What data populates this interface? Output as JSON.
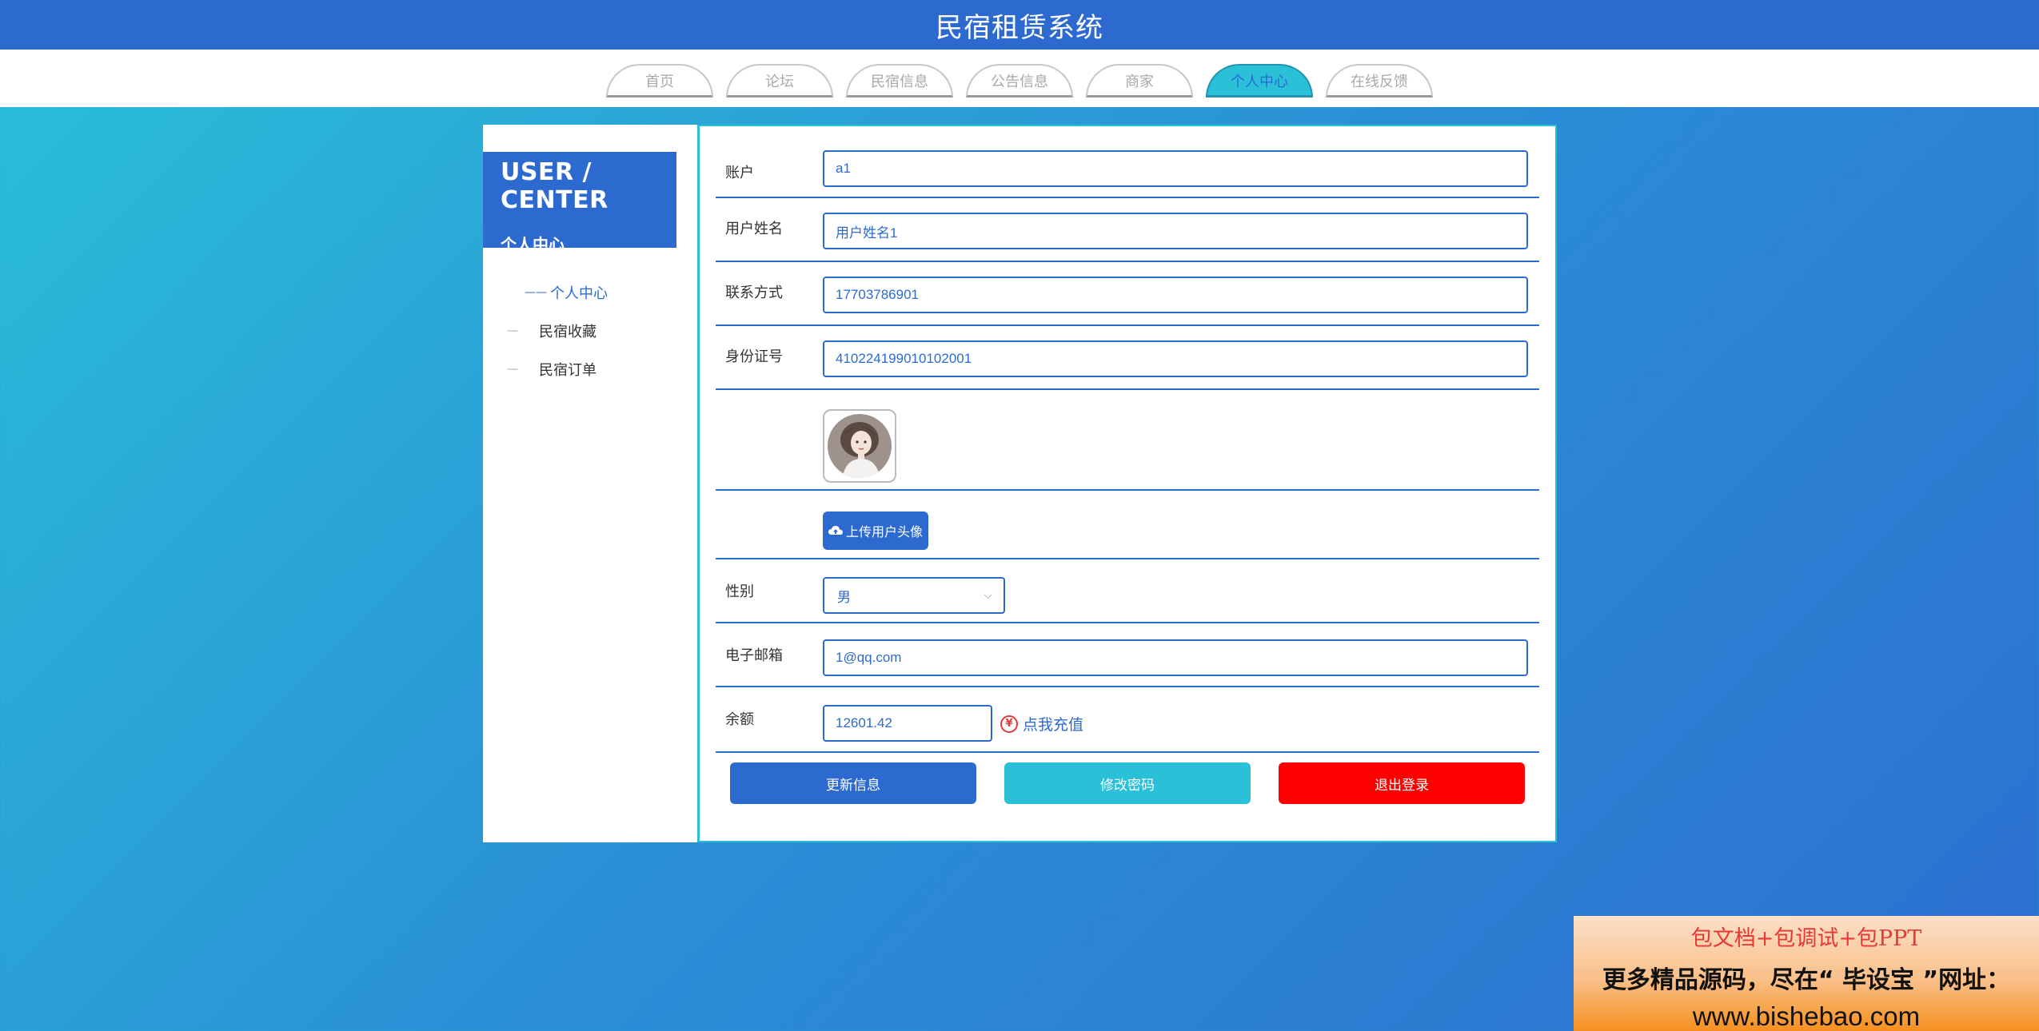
{
  "header": {
    "title": "民宿租赁系统"
  },
  "nav": {
    "tabs": [
      "首页",
      "论坛",
      "民宿信息",
      "公告信息",
      "商家",
      "个人中心",
      "在线反馈"
    ],
    "active_index": 5
  },
  "sidebar": {
    "title_en": "USER / CENTER",
    "title_cn": "个人中心",
    "items": [
      {
        "label": "个人中心",
        "dash": "——"
      },
      {
        "label": "民宿收藏",
        "dash": "—"
      },
      {
        "label": "民宿订单",
        "dash": "—"
      }
    ]
  },
  "form": {
    "account": {
      "label": "账户",
      "value": "a1"
    },
    "username": {
      "label": "用户姓名",
      "value": "用户姓名1"
    },
    "phone": {
      "label": "联系方式",
      "value": "17703786901"
    },
    "id_card": {
      "label": "身份证号",
      "value": "410224199010102001"
    },
    "upload_label": "上传用户头像",
    "gender": {
      "label": "性别",
      "value": "男"
    },
    "email": {
      "label": "电子邮箱",
      "value": "1@qq.com"
    },
    "balance": {
      "label": "余额",
      "value": "12601.42",
      "recharge": "点我充值",
      "yen": "¥"
    }
  },
  "buttons": {
    "update": "更新信息",
    "change_password": "修改密码",
    "logout": "退出登录"
  },
  "colors": {
    "primary": "#2c6ad0",
    "cyan": "#29c0d8",
    "danger": "#ff0000"
  },
  "watermark": {
    "line1": "包文档+包调试+包PPT",
    "line2": "更多精品源码，尽在“ 毕设宝 ”网址：",
    "line3": "www.bishebao.com"
  }
}
